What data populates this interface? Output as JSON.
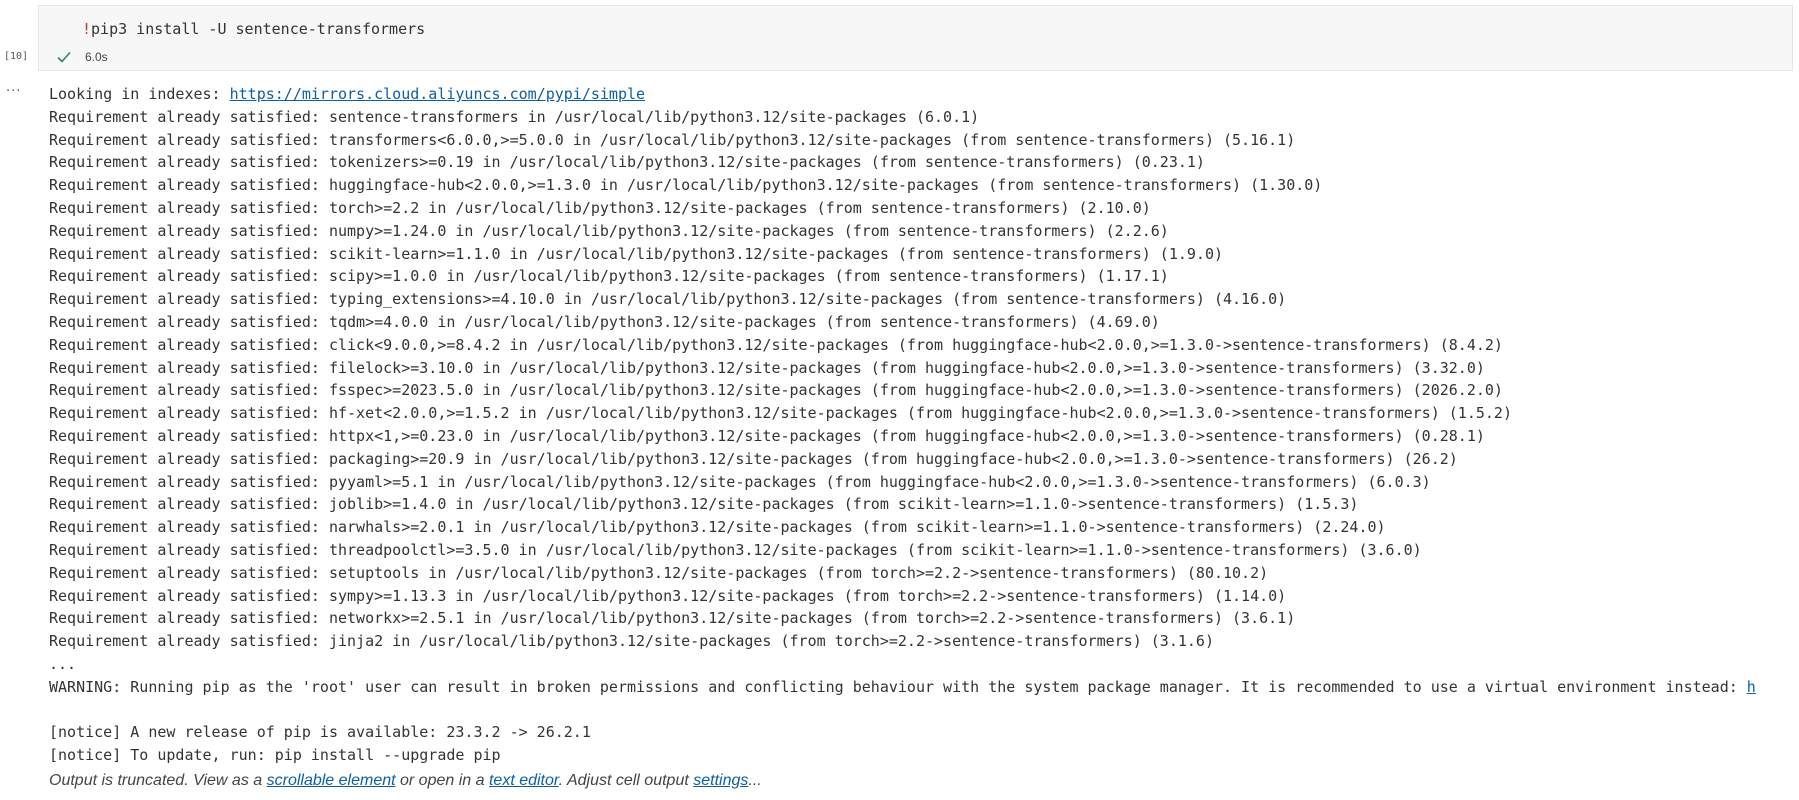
{
  "cell": {
    "index_label": "[10]",
    "code_bang": "!",
    "code_text": "pip3 install -U sentence-transformers",
    "exec_time": "6.0s",
    "status_icon": "check-icon",
    "status_color": "#2e8b57"
  },
  "output_menu_label": "...",
  "output": {
    "index_prefix": "Looking in indexes: ",
    "index_url": "https://mirrors.cloud.aliyuncs.com/pypi/simple",
    "lines": [
      "Requirement already satisfied: sentence-transformers in /usr/local/lib/python3.12/site-packages (6.0.1)",
      "Requirement already satisfied: transformers<6.0.0,>=5.0.0 in /usr/local/lib/python3.12/site-packages (from sentence-transformers) (5.16.1)",
      "Requirement already satisfied: tokenizers>=0.19 in /usr/local/lib/python3.12/site-packages (from sentence-transformers) (0.23.1)",
      "Requirement already satisfied: huggingface-hub<2.0.0,>=1.3.0 in /usr/local/lib/python3.12/site-packages (from sentence-transformers) (1.30.0)",
      "Requirement already satisfied: torch>=2.2 in /usr/local/lib/python3.12/site-packages (from sentence-transformers) (2.10.0)",
      "Requirement already satisfied: numpy>=1.24.0 in /usr/local/lib/python3.12/site-packages (from sentence-transformers) (2.2.6)",
      "Requirement already satisfied: scikit-learn>=1.1.0 in /usr/local/lib/python3.12/site-packages (from sentence-transformers) (1.9.0)",
      "Requirement already satisfied: scipy>=1.0.0 in /usr/local/lib/python3.12/site-packages (from sentence-transformers) (1.17.1)",
      "Requirement already satisfied: typing_extensions>=4.10.0 in /usr/local/lib/python3.12/site-packages (from sentence-transformers) (4.16.0)",
      "Requirement already satisfied: tqdm>=4.0.0 in /usr/local/lib/python3.12/site-packages (from sentence-transformers) (4.69.0)",
      "Requirement already satisfied: click<9.0.0,>=8.4.2 in /usr/local/lib/python3.12/site-packages (from huggingface-hub<2.0.0,>=1.3.0->sentence-transformers) (8.4.2)",
      "Requirement already satisfied: filelock>=3.10.0 in /usr/local/lib/python3.12/site-packages (from huggingface-hub<2.0.0,>=1.3.0->sentence-transformers) (3.32.0)",
      "Requirement already satisfied: fsspec>=2023.5.0 in /usr/local/lib/python3.12/site-packages (from huggingface-hub<2.0.0,>=1.3.0->sentence-transformers) (2026.2.0)",
      "Requirement already satisfied: hf-xet<2.0.0,>=1.5.2 in /usr/local/lib/python3.12/site-packages (from huggingface-hub<2.0.0,>=1.3.0->sentence-transformers) (1.5.2)",
      "Requirement already satisfied: httpx<1,>=0.23.0 in /usr/local/lib/python3.12/site-packages (from huggingface-hub<2.0.0,>=1.3.0->sentence-transformers) (0.28.1)",
      "Requirement already satisfied: packaging>=20.9 in /usr/local/lib/python3.12/site-packages (from huggingface-hub<2.0.0,>=1.3.0->sentence-transformers) (26.2)",
      "Requirement already satisfied: pyyaml>=5.1 in /usr/local/lib/python3.12/site-packages (from huggingface-hub<2.0.0,>=1.3.0->sentence-transformers) (6.0.3)",
      "Requirement already satisfied: joblib>=1.4.0 in /usr/local/lib/python3.12/site-packages (from scikit-learn>=1.1.0->sentence-transformers) (1.5.3)",
      "Requirement already satisfied: narwhals>=2.0.1 in /usr/local/lib/python3.12/site-packages (from scikit-learn>=1.1.0->sentence-transformers) (2.24.0)",
      "Requirement already satisfied: threadpoolctl>=3.5.0 in /usr/local/lib/python3.12/site-packages (from scikit-learn>=1.1.0->sentence-transformers) (3.6.0)",
      "Requirement already satisfied: setuptools in /usr/local/lib/python3.12/site-packages (from torch>=2.2->sentence-transformers) (80.10.2)",
      "Requirement already satisfied: sympy>=1.13.3 in /usr/local/lib/python3.12/site-packages (from torch>=2.2->sentence-transformers) (1.14.0)",
      "Requirement already satisfied: networkx>=2.5.1 in /usr/local/lib/python3.12/site-packages (from torch>=2.2->sentence-transformers) (3.6.1)",
      "Requirement already satisfied: jinja2 in /usr/local/lib/python3.12/site-packages (from torch>=2.2->sentence-transformers) (3.1.6)",
      "...",
      "WARNING: Running pip as the 'root' user can result in broken permissions and conflicting behaviour with the system package manager. It is recommended to use a virtual environment instead: ",
      "",
      "[notice] A new release of pip is available: 23.3.2 -> 26.2.1",
      "[notice] To update, run: pip install --upgrade pip"
    ],
    "warning_link_fragment": "h"
  },
  "truncation": {
    "text_1": "Output is truncated. View as a ",
    "link_scrollable": "scrollable element",
    "text_2": " or open in a ",
    "link_editor": "text editor",
    "text_3": ". Adjust cell output ",
    "link_settings": "settings",
    "text_4": "..."
  }
}
